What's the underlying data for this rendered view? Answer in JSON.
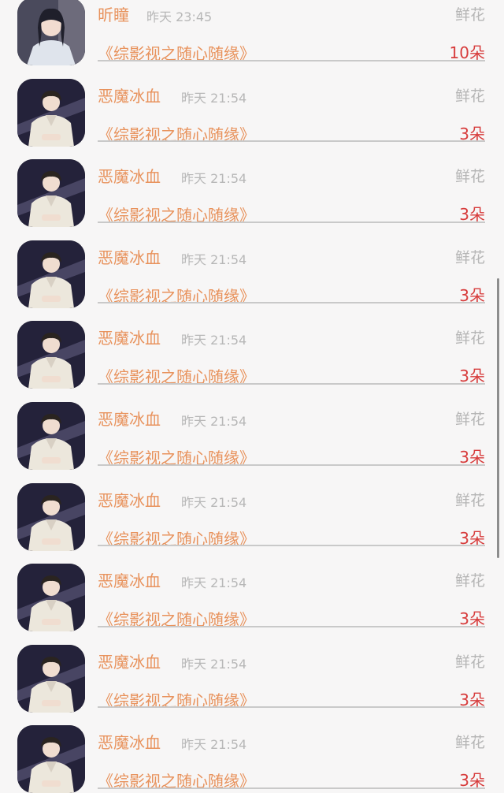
{
  "gift_type": "鲜花",
  "book_title": "《综影视之随心随缘》",
  "rows": [
    {
      "user": "昕瞳",
      "time": "昨天 23:45",
      "count": "10朵",
      "avatar": "girl-avatar"
    },
    {
      "user": "恶魔冰血",
      "time": "昨天 21:54",
      "count": "3朵",
      "avatar": "man-avatar"
    },
    {
      "user": "恶魔冰血",
      "time": "昨天 21:54",
      "count": "3朵",
      "avatar": "man-avatar"
    },
    {
      "user": "恶魔冰血",
      "time": "昨天 21:54",
      "count": "3朵",
      "avatar": "man-avatar"
    },
    {
      "user": "恶魔冰血",
      "time": "昨天 21:54",
      "count": "3朵",
      "avatar": "man-avatar"
    },
    {
      "user": "恶魔冰血",
      "time": "昨天 21:54",
      "count": "3朵",
      "avatar": "man-avatar"
    },
    {
      "user": "恶魔冰血",
      "time": "昨天 21:54",
      "count": "3朵",
      "avatar": "man-avatar"
    },
    {
      "user": "恶魔冰血",
      "time": "昨天 21:54",
      "count": "3朵",
      "avatar": "man-avatar"
    },
    {
      "user": "恶魔冰血",
      "time": "昨天 21:54",
      "count": "3朵",
      "avatar": "man-avatar"
    },
    {
      "user": "恶魔冰血",
      "time": "昨天 21:54",
      "count": "3朵",
      "avatar": "man-avatar"
    }
  ]
}
